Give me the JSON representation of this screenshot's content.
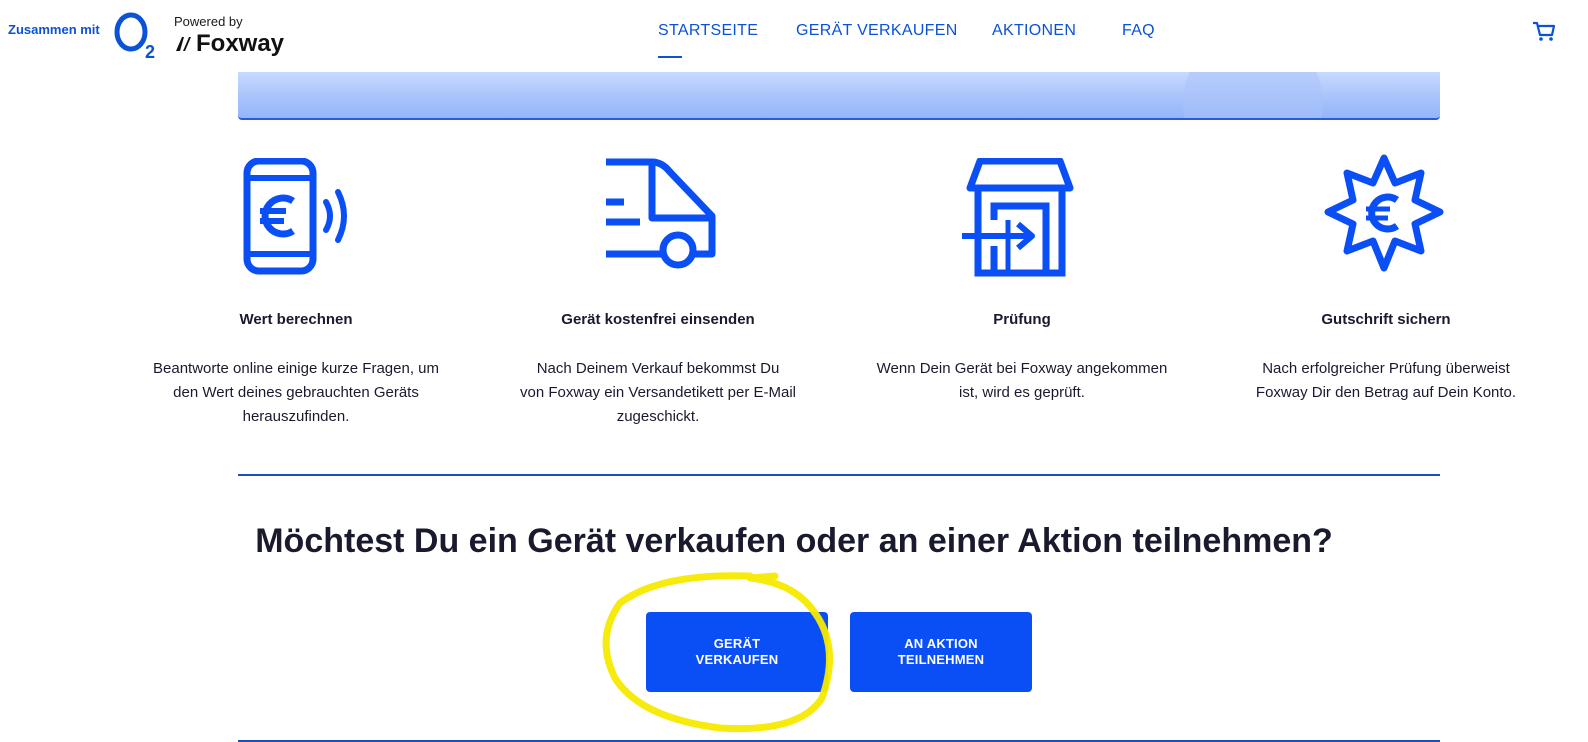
{
  "header": {
    "together_label": "Zusammen mit",
    "powered_label": "Powered by",
    "brand_name": "Foxway",
    "nav": [
      {
        "label": "STARTSEITE",
        "active": true
      },
      {
        "label": "GERÄT VERKAUFEN",
        "active": false
      },
      {
        "label": "AKTIONEN",
        "active": false
      },
      {
        "label": "FAQ",
        "active": false
      }
    ],
    "cart_icon": "cart-icon"
  },
  "steps": [
    {
      "icon": "phone-euro-icon",
      "title": "Wert berechnen",
      "desc_lines": [
        "Beantworte online einige kurze Fragen, um",
        "den Wert deines gebrauchten Geräts",
        "herauszufinden."
      ]
    },
    {
      "icon": "delivery-truck-icon",
      "title": "Gerät kostenfrei einsenden",
      "desc_lines": [
        "Nach Deinem Verkauf bekommst Du",
        "von Foxway ein Versandetikett per E-Mail",
        "zugeschickt."
      ]
    },
    {
      "icon": "warehouse-icon",
      "title": "Prüfung",
      "desc_lines": [
        "Wenn Dein Gerät bei Foxway angekommen",
        "ist, wird es geprüft."
      ]
    },
    {
      "icon": "euro-badge-icon",
      "title": "Gutschrift sichern",
      "desc_lines": [
        "Nach erfolgreicher Prüfung überweist",
        "Foxway Dir den Betrag auf Dein Konto."
      ]
    }
  ],
  "cta": {
    "title": "Möchtest Du ein Gerät verkaufen oder an einer Aktion teilnehmen?",
    "buttons": [
      {
        "line1": "GERÄT",
        "line2": "VERKAUFEN"
      },
      {
        "line1": "AN AKTION",
        "line2": "TEILNEHMEN"
      }
    ]
  },
  "colors": {
    "brand_blue": "#0a52d6",
    "button_blue": "#0a4ff5",
    "highlight_yellow": "#f5ea00"
  }
}
